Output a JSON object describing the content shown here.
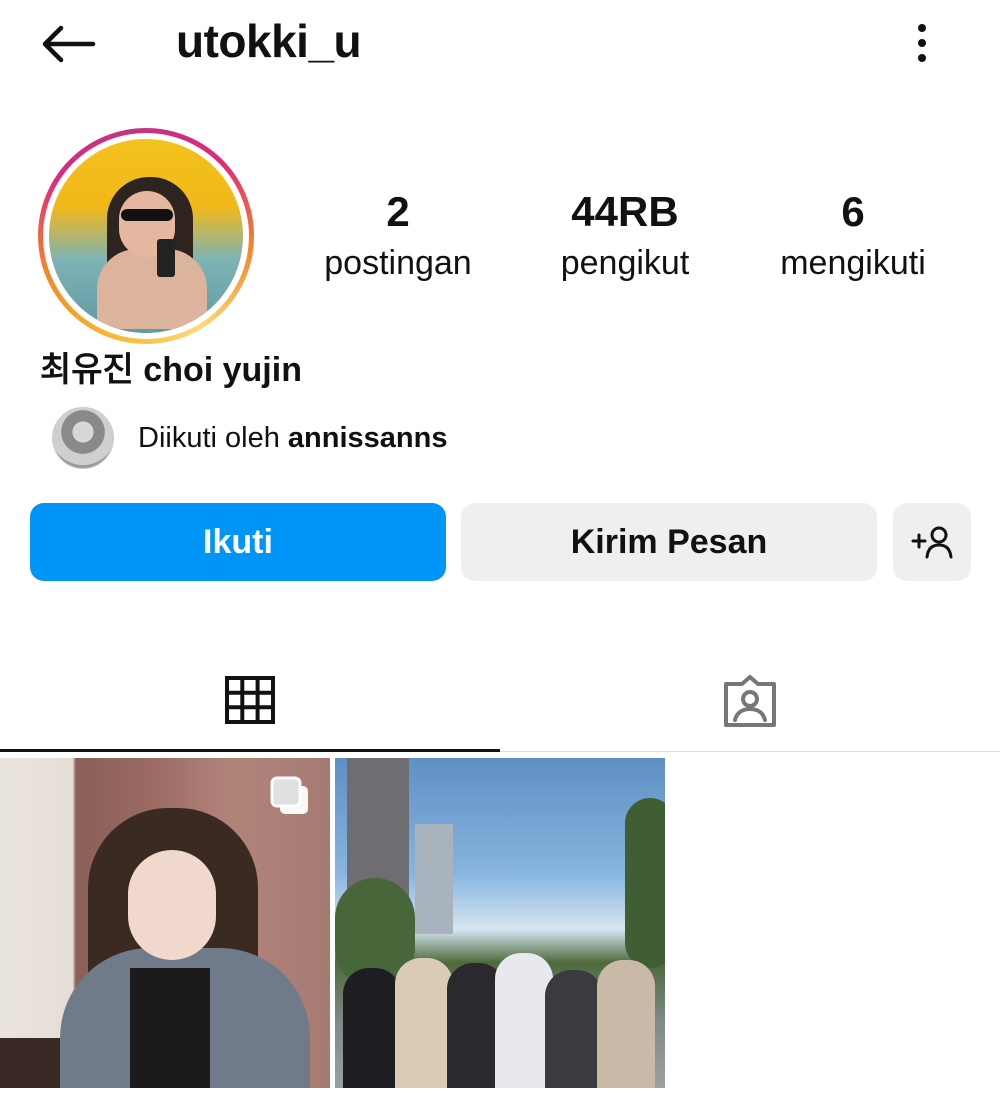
{
  "header": {
    "username": "utokki_u"
  },
  "profile": {
    "display_name": "최유진 choi yujin",
    "stats": [
      {
        "value": "2",
        "label": "postingan"
      },
      {
        "value": "44RB",
        "label": "pengikut"
      },
      {
        "value": "6",
        "label": "mengikuti"
      }
    ],
    "followed_by_prefix": "Diikuti oleh ",
    "followed_by_user": "annissanns"
  },
  "actions": {
    "follow_label": "Ikuti",
    "message_label": "Kirim Pesan",
    "suggest_icon": "add-person-icon"
  },
  "tabs": [
    {
      "icon": "grid-icon",
      "active": true
    },
    {
      "icon": "tagged-icon",
      "active": false
    }
  ],
  "posts": [
    {
      "type": "carousel",
      "icon": "multiple-photos-icon"
    },
    {
      "type": "single"
    }
  ],
  "colors": {
    "accent": "#0095f6",
    "secondary_button": "#efefef",
    "text": "#111111"
  }
}
